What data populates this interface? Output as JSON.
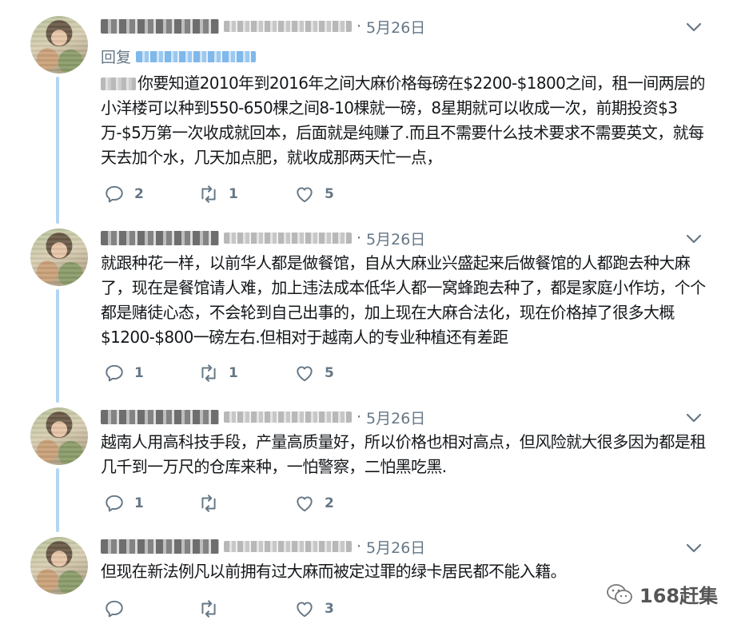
{
  "colors": {
    "thread_line": "#b4d6f2",
    "secondary_text": "#657786",
    "primary_text": "#14171a",
    "link": "#1da1f2"
  },
  "tweets": [
    {
      "date": "5月26日",
      "reply_prefix": "回复",
      "text": "你要知道2010年到2016年之间大麻价格每磅在$2200-$1800之间，租一间两层的小洋楼可以种到550-650棵之间8-10棵就一磅，8星期就可以收成一次，前期投资$3万-$5万第一次收成就回本，后面就是纯赚了.而且不需要什么技术要求不需要英文，就每天去加个水，几天加点肥，就收成那两天忙一点，",
      "replies": "2",
      "retweets": "1",
      "likes": "5"
    },
    {
      "date": "5月26日",
      "text": "就跟种花一样，以前华人都是做餐馆，自从大麻业兴盛起来后做餐馆的人都跑去种大麻了，现在是餐馆请人难，加上违法成本低华人都一窝蜂跑去种了，都是家庭小作坊，个个都是赌徒心态，不会轮到自己出事的，加上现在大麻合法化，现在价格掉了很多大概$1200-$800一磅左右.但相对于越南人的专业种植还有差距",
      "replies": "1",
      "retweets": "1",
      "likes": "5"
    },
    {
      "date": "5月26日",
      "text": "越南人用高科技手段，产量高质量好，所以价格也相对高点，但风险就大很多因为都是租几千到一万尺的仓库来种，一怕警察，二怕黑吃黑.",
      "replies": "1",
      "retweets": "",
      "likes": "2"
    },
    {
      "date": "5月26日",
      "text": "但现在新法例凡以前拥有过大麻而被定过罪的绿卡居民都不能入籍。",
      "replies": "",
      "retweets": "",
      "likes": "3"
    }
  ],
  "separator": "·",
  "icons": [
    "chevron-down-icon",
    "reply-icon",
    "retweet-icon",
    "like-icon",
    "wechat-icon"
  ],
  "watermark": "168赶集"
}
